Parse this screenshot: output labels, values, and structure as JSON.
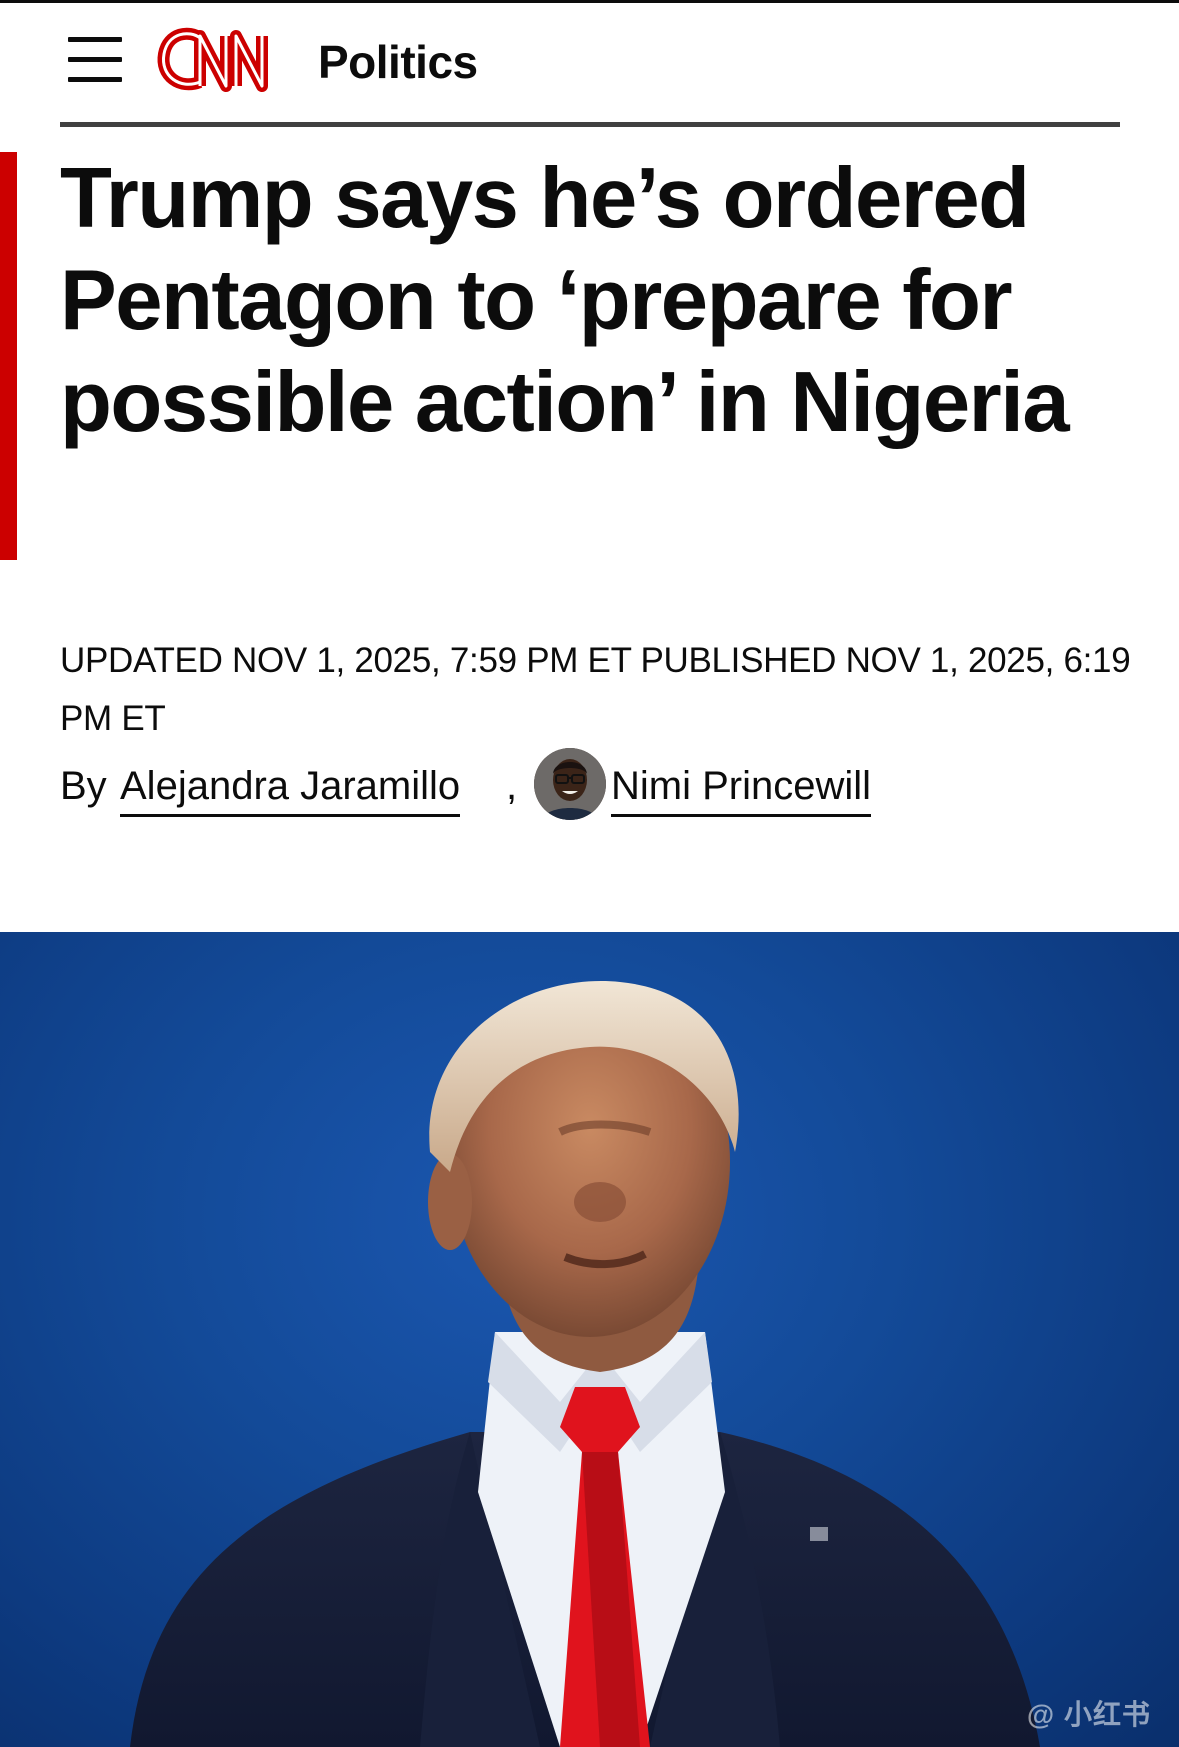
{
  "header": {
    "menu_icon": "hamburger-menu-icon",
    "logo_text": "CNN",
    "section": "Politics"
  },
  "colors": {
    "brand_red": "#cc0000",
    "text": "#0c0c0c",
    "rule": "#404040",
    "hero_background": "#134a98"
  },
  "article": {
    "headline": "Trump says he’s ordered Pentagon to ‘prepare for possible action’ in Nigeria",
    "timestamp": "UPDATED NOV 1, 2025, 7:59 PM ET PUBLISHED NOV 1, 2025, 6:19 PM ET",
    "byline": {
      "prefix": "By",
      "separator": ",",
      "authors": [
        {
          "name": "Alejandra Jaramillo",
          "has_photo": false
        },
        {
          "name": "Nimi Princewill",
          "has_photo": true
        }
      ]
    }
  },
  "hero_image": {
    "subject": "man in dark suit with red tie against blue sky",
    "watermark": "@ 小红书"
  }
}
